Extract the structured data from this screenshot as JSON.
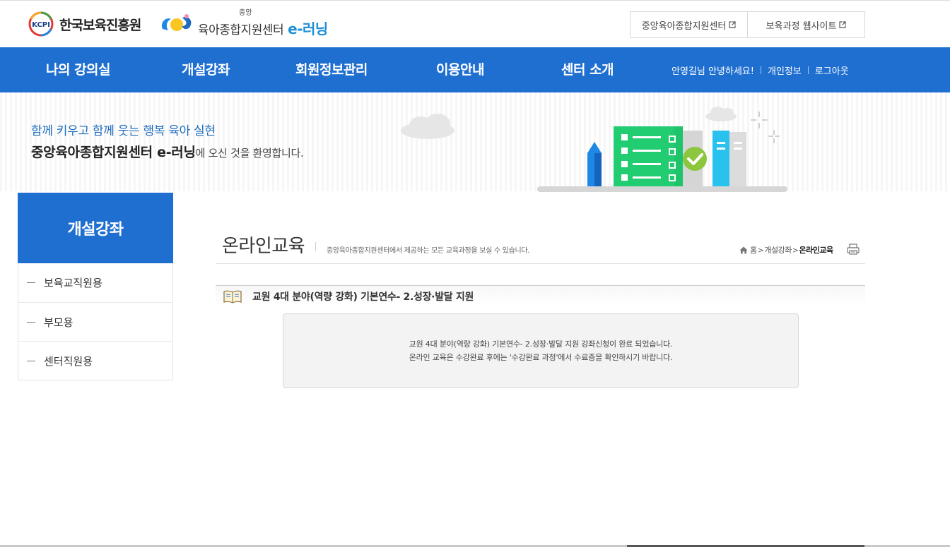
{
  "header": {
    "kcpi_badge": "KCPI",
    "kcpi_name": "한국보육진흥원",
    "center_small": "중앙",
    "center_name": "육아종합지원센터",
    "center_elearning": "e-러닝",
    "links": [
      {
        "label": "중앙육아종합지원센터",
        "icon": "external-link-icon"
      },
      {
        "label": "보육과정 웹사이트",
        "icon": "external-link-icon"
      }
    ]
  },
  "nav": {
    "items": [
      {
        "label": "나의 강의실"
      },
      {
        "label": "개설강좌"
      },
      {
        "label": "회원정보관리"
      },
      {
        "label": "이용안내"
      },
      {
        "label": "센터 소개"
      }
    ],
    "greeting": "안영길님 안녕하세요!",
    "personal_info": "개인정보",
    "logout": "로그아웃"
  },
  "banner": {
    "slogan": "함께 키우고 함께 웃는 행복 육아 실현",
    "welcome_bold": "중앙육아종합지원센터 e-러닝",
    "welcome_rest": "에 오신 것을 환영합니다."
  },
  "sidebar": {
    "title": "개설강좌",
    "items": [
      {
        "label": "보육교직원용"
      },
      {
        "label": "부모용"
      },
      {
        "label": "센터직원용"
      }
    ]
  },
  "main": {
    "title": "온라인교육",
    "description": "중앙육아종합지원센터에서 제공하는 모든 교육과정을 보실 수 있습니다.",
    "breadcrumb": {
      "home": "홈",
      "level1": "개설강좌",
      "current": "온라인교육"
    },
    "course_title": "교원 4대 분야(역량 강화) 기본연수- 2.성장·발달 지원",
    "message_lines": [
      "교원 4대 분야(역량 강화) 기본연수- 2.성장·발달 지원 강좌신청이 완료 되었습니다.",
      "온라인 교육은 수강완료 후에는 '수강완료 과정'에서 수료증을 확인하시기 바랍니다."
    ]
  },
  "colors": {
    "nav_blue": "#1f6fd1",
    "slogan_blue": "#1e6cbf",
    "elearning_blue": "#1e8fd6",
    "book_green": "#1fc46a",
    "check_green": "#8cc63f"
  }
}
